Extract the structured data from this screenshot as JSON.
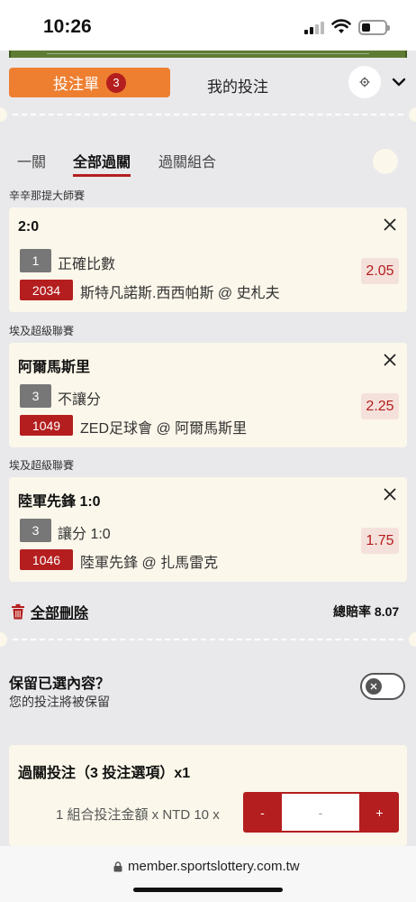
{
  "status_bar": {
    "time": "10:26"
  },
  "header": {
    "betslip_label": "投注單",
    "betslip_count": "3",
    "mybets_label": "我的投注"
  },
  "subtabs": [
    "一關",
    "全部過關",
    "過關組合"
  ],
  "bets": [
    {
      "league": "辛辛那提大師賽",
      "title": "2:0",
      "market_code": "1",
      "market_name": "正確比數",
      "match_code": "2034",
      "match_name": "斯特凡諾斯.西西帕斯 @ 史札夫",
      "odds": "2.05"
    },
    {
      "league": "埃及超級聯賽",
      "title": "阿爾馬斯里",
      "market_code": "3",
      "market_name": "不讓分",
      "match_code": "1049",
      "match_name": "ZED足球會 @ 阿爾馬斯里",
      "odds": "2.25"
    },
    {
      "league": "埃及超級聯賽",
      "title": "陸軍先鋒 1:0",
      "market_code": "3",
      "market_name": "讓分 1:0",
      "match_code": "1046",
      "match_name": "陸軍先鋒 @ 扎馬雷克",
      "odds": "1.75"
    }
  ],
  "footer": {
    "delete_all_label": "全部刪除",
    "total_odds_label": "總賠率",
    "total_odds_value": "8.07"
  },
  "keep": {
    "title": "保留已選內容？",
    "subtitle": "您的投注將被保留"
  },
  "parlay": {
    "title": "過關投注（3 投注選項）x1",
    "stake_label": "1 組合投注金額 x NTD 10 x",
    "minus": "-",
    "input_value": "-",
    "plus": "+"
  },
  "browser": {
    "url": "member.sportslottery.com.tw"
  },
  "colors": {
    "accent_orange": "#ee7f31",
    "accent_red": "#b41e1e",
    "card_bg": "#fbf7ea",
    "page_bg": "#e9e9ec"
  }
}
